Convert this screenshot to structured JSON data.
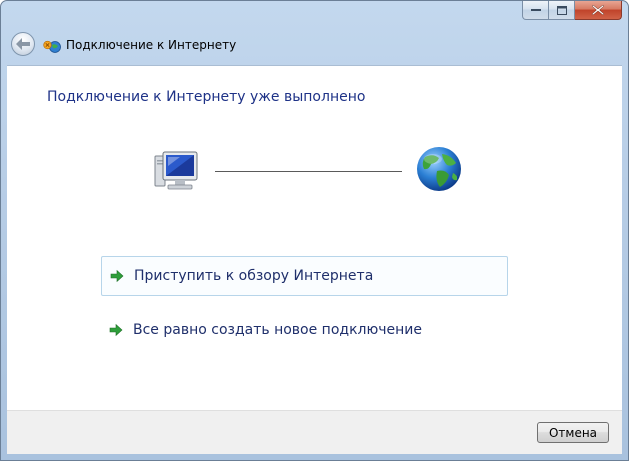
{
  "window": {
    "title": "Подключение к Интернету",
    "controls": {
      "minimize_icon": "minimize-icon",
      "maximize_icon": "maximize-icon",
      "close_icon": "close-icon"
    }
  },
  "nav": {
    "back_icon": "back-arrow-icon",
    "app_icon": "network-connection-icon"
  },
  "main": {
    "headline": "Подключение к Интернету уже выполнено",
    "diagram": {
      "left_icon": "computer-icon",
      "right_icon": "globe-icon"
    },
    "options": [
      {
        "label": "Приступить к обзору Интернета",
        "icon": "green-arrow-icon"
      },
      {
        "label": "Все равно создать новое подключение",
        "icon": "green-arrow-icon"
      }
    ]
  },
  "footer": {
    "cancel_label": "Отмена"
  },
  "colors": {
    "headline": "#1e3287",
    "link": "#1f2f6b",
    "arrow": "#2e9e3a",
    "link_hover_border": "#b7d5ea"
  }
}
